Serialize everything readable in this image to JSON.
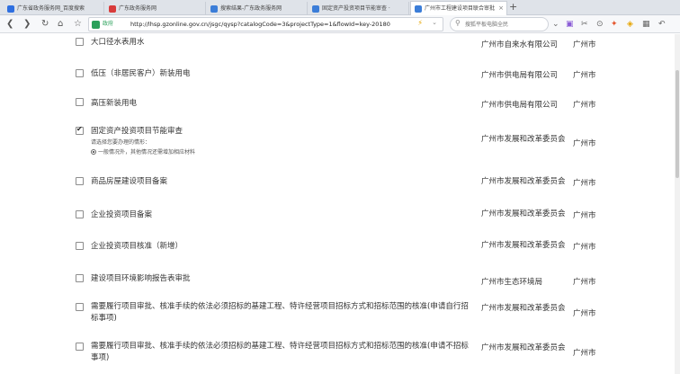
{
  "tabs": [
    {
      "label": "广东省政务服务网_百度搜索",
      "favicon_color": "#2f6fe0"
    },
    {
      "label": "广东政务服务网",
      "favicon_color": "#d83b3b"
    },
    {
      "label": "搜索结果-广东政务服务网",
      "favicon_color": "#3b7dd8"
    },
    {
      "label": "固定资产投资项目节能审查 ·",
      "favicon_color": "#3b7dd8"
    },
    {
      "label": "广州市工程建设项目联合审批",
      "favicon_color": "#3b7dd8"
    }
  ],
  "new_tab_label": "+",
  "address": {
    "gov_label": "政府",
    "url": "http://lhsp.gzonline.gov.cn/jsgc/qysp?catalogCode=3&projectType=1&flowId=key-20180"
  },
  "search": {
    "placeholder": "搜狐平板电脑全民"
  },
  "items": [
    {
      "title": "大口径水表用水",
      "checked": false,
      "dept": "广州市自来水有限公司",
      "city": "广州市"
    },
    {
      "title": "低压（非居民客户）新装用电",
      "checked": false,
      "dept": "广州市供电局有限公司",
      "city": "广州市"
    },
    {
      "title": "高压新装用电",
      "checked": false,
      "dept": "广州市供电局有限公司",
      "city": "广州市"
    },
    {
      "title": "固定资产投资项目节能审查",
      "checked": true,
      "sub1": "请选择您要办理的情形：",
      "sub2": "一般情况外，其他情况还需增加相应材料",
      "dept": "广州市发展和改革委员会",
      "city": "广州市"
    },
    {
      "title": "商品房屋建设项目备案",
      "checked": false,
      "dept": "广州市发展和改革委员会",
      "city": "广州市"
    },
    {
      "title": "企业投资项目备案",
      "checked": false,
      "dept": "广州市发展和改革委员会",
      "city": "广州市"
    },
    {
      "title": "企业投资项目核准（新增）",
      "checked": false,
      "dept": "广州市发展和改革委员会",
      "city": "广州市"
    },
    {
      "title": "建设项目环境影响报告表审批",
      "checked": false,
      "dept": "广州市生态环境局",
      "city": "广州市"
    },
    {
      "title": "需要履行项目审批、核准手续的依法必须招标的基建工程、特许经营项目招标方式和招标范围的核准(申请自行招标事项)",
      "checked": false,
      "dept": "广州市发展和改革委员会",
      "city": "广州市"
    },
    {
      "title": "需要履行项目审批、核准手续的依法必须招标的基建工程、特许经营项目招标方式和招标范围的核准(申请不招标事项)",
      "checked": false,
      "dept": "广州市发展和改革委员会",
      "city": "广州市"
    }
  ]
}
